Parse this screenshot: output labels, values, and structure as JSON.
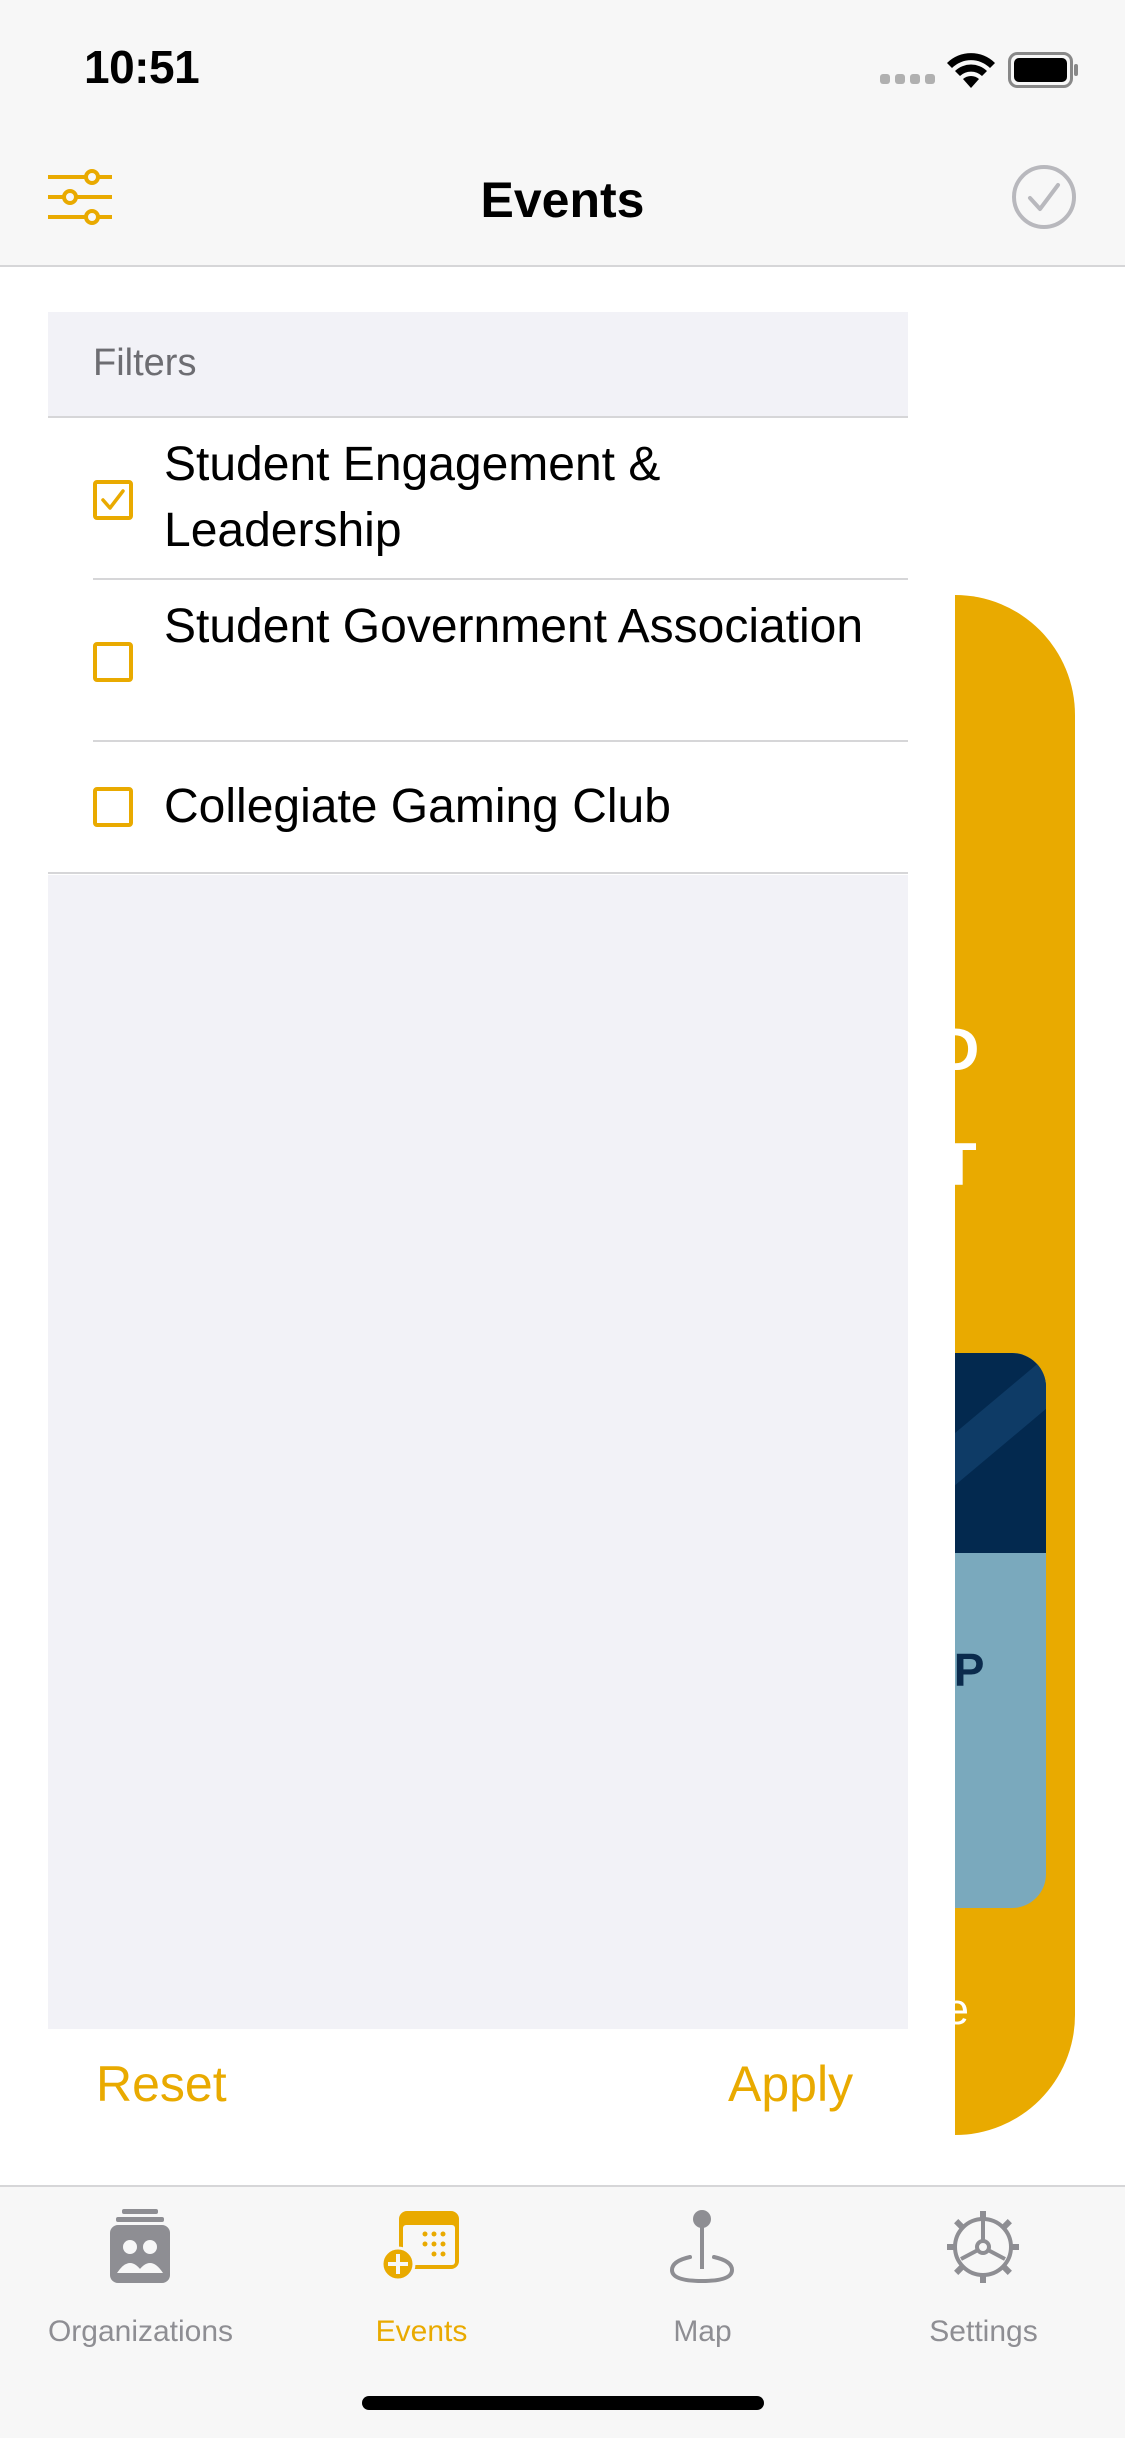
{
  "status_bar": {
    "time": "10:51"
  },
  "nav": {
    "title": "Events"
  },
  "panel": {
    "header": "Filters",
    "items": [
      {
        "label": "Student Engagement & Leadership",
        "checked": true
      },
      {
        "label": "Student Government Association",
        "checked": false
      },
      {
        "label": "Collegiate Gaming Club",
        "checked": false
      }
    ],
    "reset_label": "Reset",
    "apply_label": "Apply"
  },
  "background_card": {
    "glyphs": [
      "D",
      "T",
      "OP",
      "ne"
    ]
  },
  "tabs": [
    {
      "label": "Organizations",
      "icon": "organizations-icon",
      "active": false
    },
    {
      "label": "Events",
      "icon": "events-calendar-icon",
      "active": true
    },
    {
      "label": "Map",
      "icon": "map-pin-icon",
      "active": false
    },
    {
      "label": "Settings",
      "icon": "gear-icon",
      "active": false
    }
  ],
  "colors": {
    "accent": "#e9aa00",
    "inactive": "#8e8e93",
    "card": "#e9aa00"
  }
}
